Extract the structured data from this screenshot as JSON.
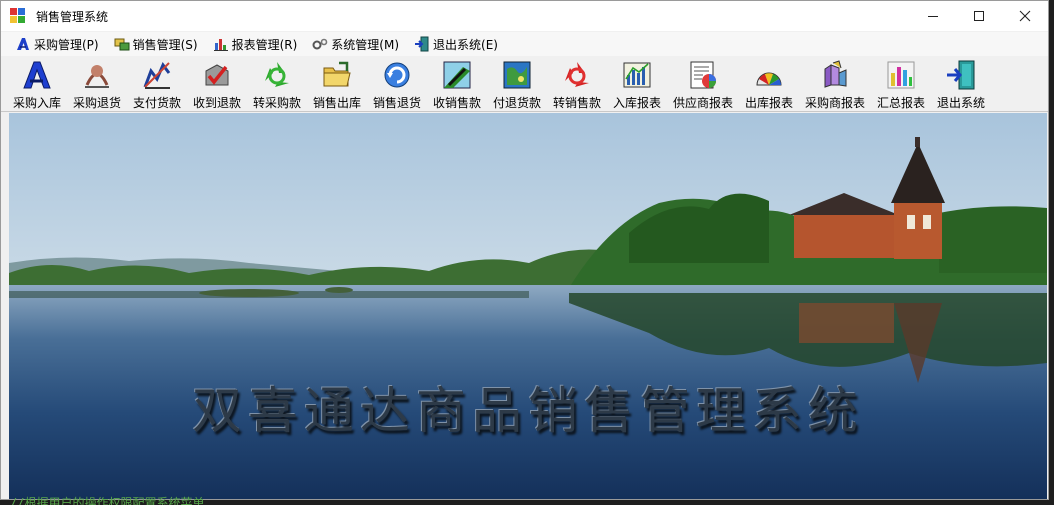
{
  "window": {
    "title": "销售管理系统"
  },
  "menubar": {
    "items": [
      {
        "label": "采购管理(P)",
        "icon": "purchase-menu-icon"
      },
      {
        "label": "销售管理(S)",
        "icon": "sales-menu-icon"
      },
      {
        "label": "报表管理(R)",
        "icon": "report-menu-icon"
      },
      {
        "label": "系统管理(M)",
        "icon": "system-menu-icon"
      },
      {
        "label": "退出系统(E)",
        "icon": "exit-menu-icon"
      }
    ]
  },
  "toolbar": {
    "buttons": [
      {
        "label": "采购入库",
        "icon": "purchase-in-icon"
      },
      {
        "label": "采购退货",
        "icon": "purchase-return-icon"
      },
      {
        "label": "支付货款",
        "icon": "pay-icon"
      },
      {
        "label": "收到退款",
        "icon": "refund-received-icon"
      },
      {
        "label": "转采购款",
        "icon": "transfer-purchase-icon"
      },
      {
        "label": "销售出库",
        "icon": "sales-out-icon"
      },
      {
        "label": "销售退货",
        "icon": "sales-return-icon"
      },
      {
        "label": "收销售款",
        "icon": "receive-payment-icon"
      },
      {
        "label": "付退货款",
        "icon": "pay-refund-icon"
      },
      {
        "label": "转销售款",
        "icon": "transfer-sales-icon"
      },
      {
        "label": "入库报表",
        "icon": "in-report-icon"
      },
      {
        "label": "供应商报表",
        "icon": "supplier-report-icon"
      },
      {
        "label": "出库报表",
        "icon": "out-report-icon"
      },
      {
        "label": "采购商报表",
        "icon": "buyer-report-icon"
      },
      {
        "label": "汇总报表",
        "icon": "summary-report-icon"
      },
      {
        "label": "退出系统",
        "icon": "exit-icon"
      }
    ]
  },
  "banner": {
    "title": "双喜通达商品销售管理系统"
  },
  "background_code": {
    "comment": "//根据用户的操作权限配置系统菜单"
  },
  "colors": {
    "window_bg": "#f0f0f0",
    "titlebar_bg": "#ffffff",
    "sky": "#c9dbea",
    "lake": "#1d3e6c",
    "trees": "#2f6b2a",
    "church_roof": "#3a2d2a",
    "church_wall": "#b5552e",
    "comment_green": "#57a64a"
  }
}
